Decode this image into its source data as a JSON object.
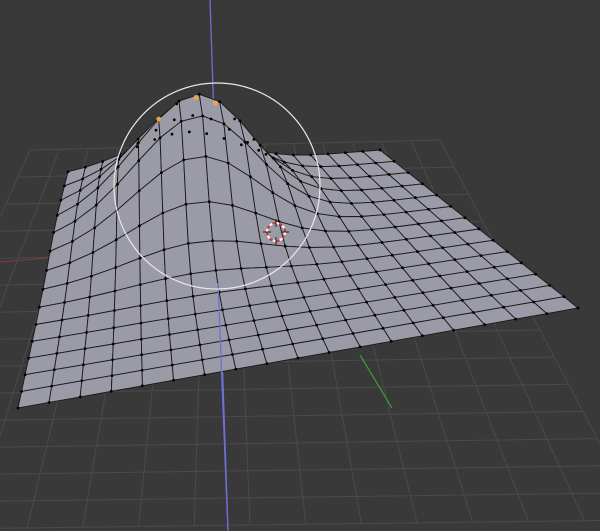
{
  "viewport": {
    "mode": "edit-mode",
    "background_color": "#393939",
    "grid_line_color": "#4a4a4a",
    "mesh_face_color": "#9a9ba6",
    "mesh_edge_color": "#1a1a1a",
    "selected_vertex_color": "#f5a042",
    "z_axis_color": "#6f6fd6",
    "x_axis_color": "#8a3a3a",
    "y_axis_color": "#3aa03a",
    "brush_circle_color": "#e8e8e8",
    "icons": {
      "cursor": "3d-cursor-icon",
      "brush": "proportional-edit-circle-icon"
    }
  }
}
